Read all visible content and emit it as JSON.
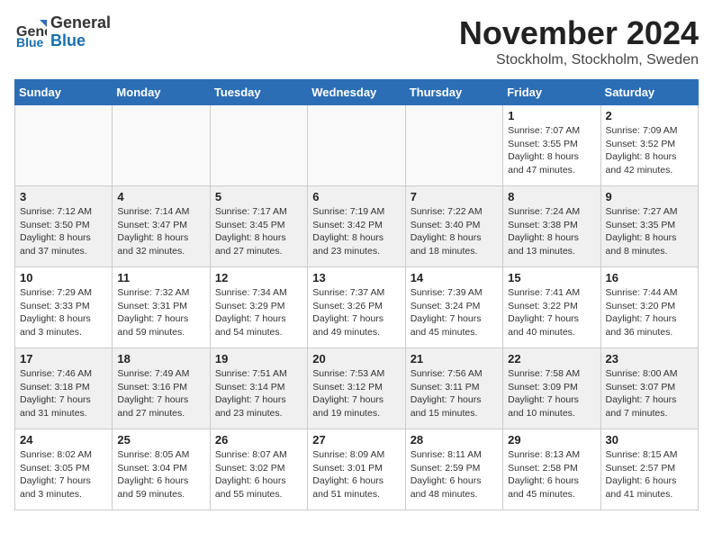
{
  "logo": {
    "general": "General",
    "blue": "Blue"
  },
  "title": "November 2024",
  "location": "Stockholm, Stockholm, Sweden",
  "days_of_week": [
    "Sunday",
    "Monday",
    "Tuesday",
    "Wednesday",
    "Thursday",
    "Friday",
    "Saturday"
  ],
  "weeks": [
    [
      {
        "day": "",
        "info": ""
      },
      {
        "day": "",
        "info": ""
      },
      {
        "day": "",
        "info": ""
      },
      {
        "day": "",
        "info": ""
      },
      {
        "day": "",
        "info": ""
      },
      {
        "day": "1",
        "info": "Sunrise: 7:07 AM\nSunset: 3:55 PM\nDaylight: 8 hours and 47 minutes."
      },
      {
        "day": "2",
        "info": "Sunrise: 7:09 AM\nSunset: 3:52 PM\nDaylight: 8 hours and 42 minutes."
      }
    ],
    [
      {
        "day": "3",
        "info": "Sunrise: 7:12 AM\nSunset: 3:50 PM\nDaylight: 8 hours and 37 minutes."
      },
      {
        "day": "4",
        "info": "Sunrise: 7:14 AM\nSunset: 3:47 PM\nDaylight: 8 hours and 32 minutes."
      },
      {
        "day": "5",
        "info": "Sunrise: 7:17 AM\nSunset: 3:45 PM\nDaylight: 8 hours and 27 minutes."
      },
      {
        "day": "6",
        "info": "Sunrise: 7:19 AM\nSunset: 3:42 PM\nDaylight: 8 hours and 23 minutes."
      },
      {
        "day": "7",
        "info": "Sunrise: 7:22 AM\nSunset: 3:40 PM\nDaylight: 8 hours and 18 minutes."
      },
      {
        "day": "8",
        "info": "Sunrise: 7:24 AM\nSunset: 3:38 PM\nDaylight: 8 hours and 13 minutes."
      },
      {
        "day": "9",
        "info": "Sunrise: 7:27 AM\nSunset: 3:35 PM\nDaylight: 8 hours and 8 minutes."
      }
    ],
    [
      {
        "day": "10",
        "info": "Sunrise: 7:29 AM\nSunset: 3:33 PM\nDaylight: 8 hours and 3 minutes."
      },
      {
        "day": "11",
        "info": "Sunrise: 7:32 AM\nSunset: 3:31 PM\nDaylight: 7 hours and 59 minutes."
      },
      {
        "day": "12",
        "info": "Sunrise: 7:34 AM\nSunset: 3:29 PM\nDaylight: 7 hours and 54 minutes."
      },
      {
        "day": "13",
        "info": "Sunrise: 7:37 AM\nSunset: 3:26 PM\nDaylight: 7 hours and 49 minutes."
      },
      {
        "day": "14",
        "info": "Sunrise: 7:39 AM\nSunset: 3:24 PM\nDaylight: 7 hours and 45 minutes."
      },
      {
        "day": "15",
        "info": "Sunrise: 7:41 AM\nSunset: 3:22 PM\nDaylight: 7 hours and 40 minutes."
      },
      {
        "day": "16",
        "info": "Sunrise: 7:44 AM\nSunset: 3:20 PM\nDaylight: 7 hours and 36 minutes."
      }
    ],
    [
      {
        "day": "17",
        "info": "Sunrise: 7:46 AM\nSunset: 3:18 PM\nDaylight: 7 hours and 31 minutes."
      },
      {
        "day": "18",
        "info": "Sunrise: 7:49 AM\nSunset: 3:16 PM\nDaylight: 7 hours and 27 minutes."
      },
      {
        "day": "19",
        "info": "Sunrise: 7:51 AM\nSunset: 3:14 PM\nDaylight: 7 hours and 23 minutes."
      },
      {
        "day": "20",
        "info": "Sunrise: 7:53 AM\nSunset: 3:12 PM\nDaylight: 7 hours and 19 minutes."
      },
      {
        "day": "21",
        "info": "Sunrise: 7:56 AM\nSunset: 3:11 PM\nDaylight: 7 hours and 15 minutes."
      },
      {
        "day": "22",
        "info": "Sunrise: 7:58 AM\nSunset: 3:09 PM\nDaylight: 7 hours and 10 minutes."
      },
      {
        "day": "23",
        "info": "Sunrise: 8:00 AM\nSunset: 3:07 PM\nDaylight: 7 hours and 7 minutes."
      }
    ],
    [
      {
        "day": "24",
        "info": "Sunrise: 8:02 AM\nSunset: 3:05 PM\nDaylight: 7 hours and 3 minutes."
      },
      {
        "day": "25",
        "info": "Sunrise: 8:05 AM\nSunset: 3:04 PM\nDaylight: 6 hours and 59 minutes."
      },
      {
        "day": "26",
        "info": "Sunrise: 8:07 AM\nSunset: 3:02 PM\nDaylight: 6 hours and 55 minutes."
      },
      {
        "day": "27",
        "info": "Sunrise: 8:09 AM\nSunset: 3:01 PM\nDaylight: 6 hours and 51 minutes."
      },
      {
        "day": "28",
        "info": "Sunrise: 8:11 AM\nSunset: 2:59 PM\nDaylight: 6 hours and 48 minutes."
      },
      {
        "day": "29",
        "info": "Sunrise: 8:13 AM\nSunset: 2:58 PM\nDaylight: 6 hours and 45 minutes."
      },
      {
        "day": "30",
        "info": "Sunrise: 8:15 AM\nSunset: 2:57 PM\nDaylight: 6 hours and 41 minutes."
      }
    ]
  ]
}
